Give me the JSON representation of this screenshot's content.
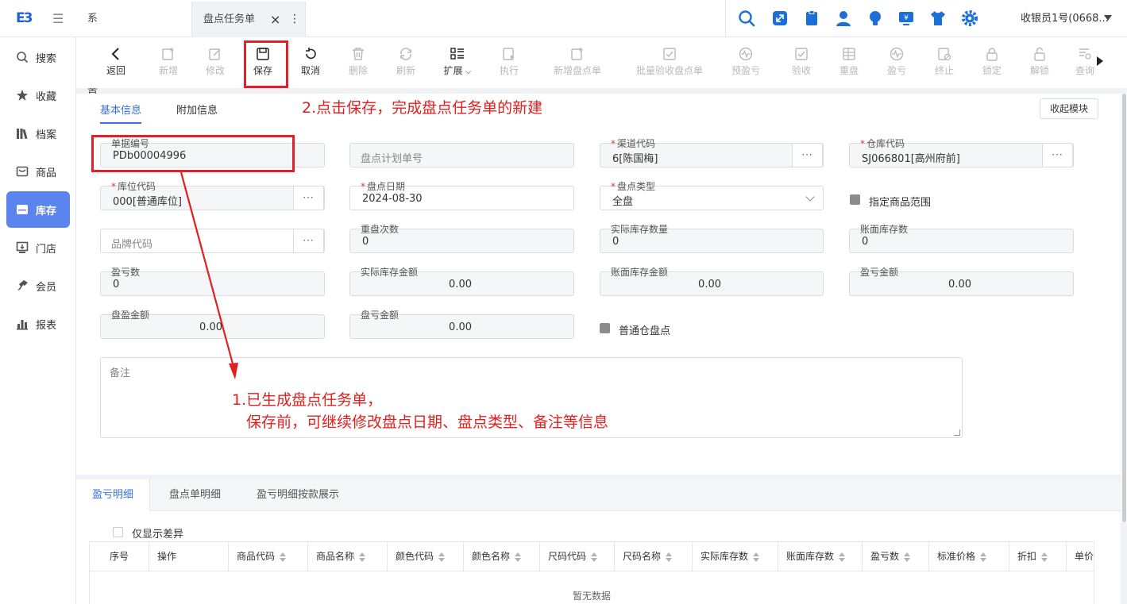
{
  "app": {
    "logo_text": "E3",
    "user": "收银员1号(0668..."
  },
  "tabs": [
    {
      "label": "系统首页"
    },
    {
      "label": "盘点任务单",
      "close": "×",
      "menu": "⋮"
    }
  ],
  "top_icons": [
    "search-icon",
    "expand-icon",
    "clipboard-icon",
    "user-icon",
    "bulb-icon",
    "monitor-icon",
    "shirt-icon",
    "gear-icon"
  ],
  "sidebar": {
    "items": [
      {
        "label": "搜索",
        "icon": "search-icon"
      },
      {
        "label": "收藏",
        "icon": "star-icon"
      },
      {
        "label": "档案",
        "icon": "archive-icon"
      },
      {
        "label": "商品",
        "icon": "goods-icon"
      },
      {
        "label": "库存",
        "icon": "inventory-icon",
        "active": true
      },
      {
        "label": "门店",
        "icon": "store-icon"
      },
      {
        "label": "会员",
        "icon": "member-icon"
      },
      {
        "label": "报表",
        "icon": "report-icon"
      }
    ]
  },
  "toolbar": {
    "back": "返回",
    "add": "新增",
    "edit": "修改",
    "save": "保存",
    "cancel": "取消",
    "delete": "删除",
    "refresh": "刷新",
    "expand": "扩展",
    "execute": "执行",
    "add_count_order": "新增盘点单",
    "batch_accept": "批量验收盘点单",
    "pre_profit": "预盈亏",
    "accept": "验收",
    "recount": "重盘",
    "profit_loss": "盈亏",
    "terminate": "终止",
    "lock": "锁定",
    "unlock": "解锁",
    "query": "查询"
  },
  "form": {
    "tabs": {
      "base": "基本信息",
      "extra": "附加信息"
    },
    "collapse": "收起模块",
    "doc_no": {
      "label": "单据编号",
      "value": "PDb00004996"
    },
    "plan_no": {
      "placeholder": "盘点计划单号"
    },
    "channel": {
      "label": "渠道代码",
      "value": "6[陈国梅]"
    },
    "warehouse": {
      "label": "仓库代码",
      "value": "SJ066801[高州府前]"
    },
    "location": {
      "label": "库位代码",
      "value": "000[普通库位]"
    },
    "count_date": {
      "label": "盘点日期",
      "value": "2024-08-30"
    },
    "count_type": {
      "label": "盘点类型",
      "value": "全盘"
    },
    "specify_range": "指定商品范围",
    "brand": {
      "placeholder": "品牌代码"
    },
    "recount_times": {
      "label": "重盘次数",
      "value": "0"
    },
    "actual_qty": {
      "label": "实际库存数量",
      "value": "0"
    },
    "book_qty": {
      "label": "账面库存数",
      "value": "0"
    },
    "profit_loss_qty": {
      "label": "盈亏数",
      "value": "0"
    },
    "actual_amount": {
      "label": "实际库存金额",
      "value": "0.00"
    },
    "book_amount": {
      "label": "账面库存金额",
      "value": "0.00"
    },
    "profit_loss_amount": {
      "label": "盈亏金额",
      "value": "0.00"
    },
    "surplus_amount": {
      "label": "盘盈金额",
      "value": "0.00"
    },
    "profit_loss_amount2": {
      "label": "盘亏金额",
      "value": "0.00"
    },
    "normal_wh_count": "普通仓盘点",
    "remark": {
      "placeholder": "备注"
    }
  },
  "dots": "···",
  "annotations": {
    "a1_line1": "1.已生成盘点任务单，",
    "a1_line2": "保存前，可继续修改盘点日期、盘点类型、备注等信息",
    "a2": "2.点击保存，完成盘点任务单的新建"
  },
  "bottom": {
    "tabs": [
      "盈亏明细",
      "盘点单明细",
      "盈亏明细按款展示"
    ],
    "only_diff": "仅显示差异",
    "columns": [
      "序号",
      "操作",
      "商品代码",
      "商品名称",
      "颜色代码",
      "颜色名称",
      "尺码代码",
      "尺码名称",
      "实际库存数",
      "账面库存数",
      "盈亏数",
      "标准价格",
      "折扣",
      "单价"
    ],
    "no_data": "暂无数据"
  },
  "colors": {
    "primary": "#3a6fe0",
    "sidebar_active": "#5b84ee",
    "annotation": "#e02020",
    "icon_blue": "#1b6fd6"
  }
}
